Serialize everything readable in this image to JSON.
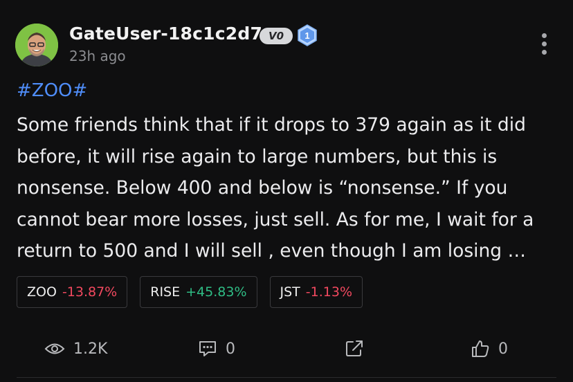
{
  "author": {
    "username": "GateUser-18c1c2d7",
    "vip_badge": "V0",
    "level_badge": "1",
    "timestamp": "23h ago",
    "avatar": "avatar-photo"
  },
  "post": {
    "hashtag": "#ZOO#",
    "text": "Some friends think that if it drops to 379 again as it did\nbefore, it will rise again to large numbers, but this is\nnonsense. Below 400 and below is “nonsense.” If you\ncannot bear more losses, just sell. As for me, I wait for a\nreturn to 500 and  I will sell , even though I am losing …"
  },
  "tickers": [
    {
      "symbol": "ZOO",
      "change": "-13.87%",
      "direction": "down"
    },
    {
      "symbol": "RISE",
      "change": "+45.83%",
      "direction": "up"
    },
    {
      "symbol": "JST",
      "change": "-1.13%",
      "direction": "down"
    }
  ],
  "footer": {
    "views": "1.2K",
    "comments": "0",
    "likes": "0"
  },
  "colors": {
    "background": "#0f0f10",
    "hashtag": "#4f8df9",
    "down": "#f2495f",
    "up": "#2fbd85",
    "avatar_bg": "#7fc244"
  },
  "icons": {
    "more": "more-vertical-icon",
    "views": "eye-icon",
    "comments": "comment-icon",
    "share": "share-icon",
    "like": "thumbs-up-icon"
  }
}
